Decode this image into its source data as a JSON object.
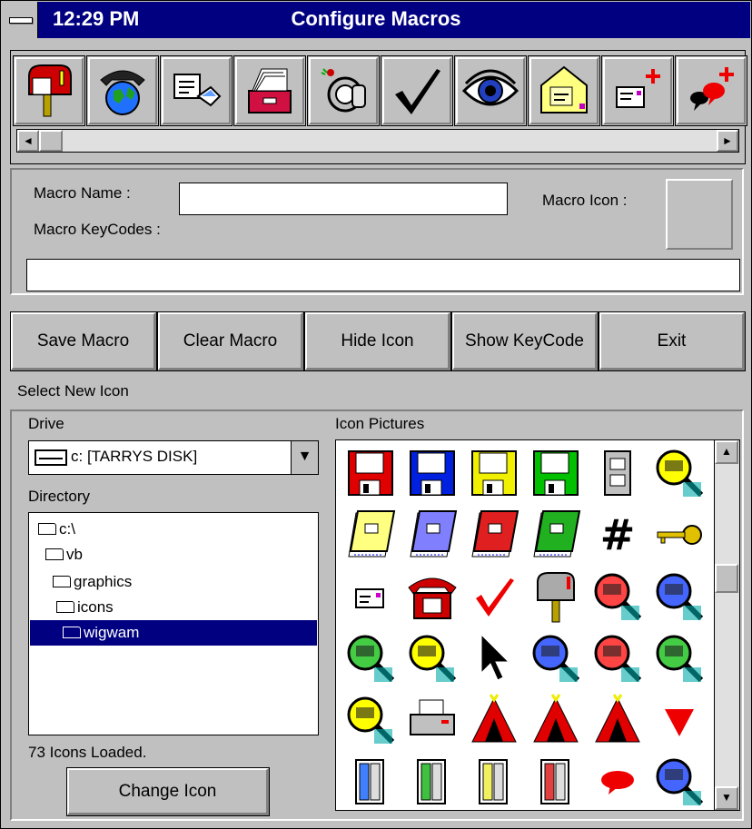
{
  "window": {
    "clock": "12:29 PM",
    "title": "Configure Macros"
  },
  "toolbar_icons": [
    {
      "name": "mailbox-icon"
    },
    {
      "name": "phone-globe-icon"
    },
    {
      "name": "mail-exchange-icon"
    },
    {
      "name": "card-file-icon"
    },
    {
      "name": "key-lock-icon"
    },
    {
      "name": "checkmark-icon"
    },
    {
      "name": "eye-icon"
    },
    {
      "name": "envelope-icon"
    },
    {
      "name": "new-mail-icon"
    },
    {
      "name": "new-chat-icon"
    }
  ],
  "macro_form": {
    "name_label": "Macro Name :",
    "name_value": "",
    "icon_label": "Macro Icon :",
    "keycodes_label": "Macro KeyCodes :",
    "keycodes_value": ""
  },
  "buttons": {
    "save": "Save Macro",
    "clear": "Clear Macro",
    "hide": "Hide Icon",
    "show": "Show KeyCode",
    "exit": "Exit"
  },
  "select_icon": {
    "section_label": "Select New Icon",
    "drive_label": "Drive",
    "drive_value": "c: [TARRYS DISK]",
    "directory_label": "Directory",
    "directories": [
      "c:\\",
      "vb",
      "graphics",
      "icons",
      "wigwam"
    ],
    "selected_directory": "wigwam",
    "status": "73 Icons Loaded.",
    "change_button": "Change Icon",
    "pictures_label": "Icon Pictures"
  },
  "icon_grid": [
    "floppy-red-icon",
    "floppy-blue-icon",
    "floppy-yellow-icon",
    "floppy-green-icon",
    "file-cabinet-icon",
    "magnifier-yellow-icon",
    "notepad-yellow-icon",
    "notepad-blue-icon",
    "notepad-red-icon",
    "notepad-green-icon",
    "hash-icon",
    "key-icon",
    "envelope-small-icon",
    "red-phone-icon",
    "red-check-icon",
    "mailbox-icon",
    "magnifier-red-icon",
    "magnifier-blue-icon",
    "magnifier-green-icon",
    "magnifier-yellow2-icon",
    "arrow-pointer-icon",
    "magnifier-blue2-icon",
    "magnifier-red2-icon",
    "magnifier-green2-icon",
    "magnifier-yellow3-icon",
    "printer-icon",
    "tent-black-icon",
    "tent-red-icon",
    "tent-red2-icon",
    "red-triangle-icon",
    "book-blue-icon",
    "book-green-icon",
    "book-yellow-icon",
    "book-red-icon",
    "red-bubble-icon",
    "magnifier-blue3-icon"
  ],
  "colors": {
    "titlebar": "#000080",
    "face": "#c0c0c0",
    "selection": "#000080"
  }
}
